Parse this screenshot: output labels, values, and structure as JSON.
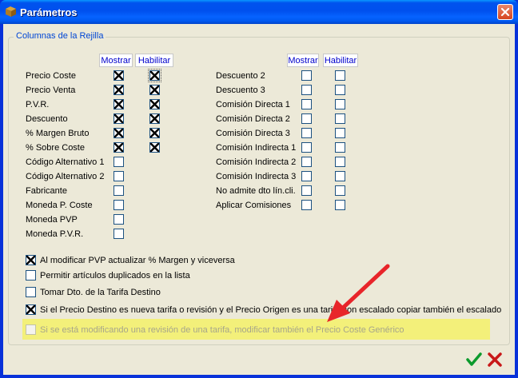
{
  "window": {
    "title": "Parámetros"
  },
  "group": {
    "title": "Columnas de la Rejilla"
  },
  "left": {
    "headers": [
      "Mostrar",
      "Habilitar"
    ],
    "rows": [
      {
        "label": "Precio Coste",
        "show": true,
        "enable": true,
        "enable_focus": true
      },
      {
        "label": "Precio Venta",
        "show": true,
        "enable": true
      },
      {
        "label": "P.V.R.",
        "show": true,
        "enable": true
      },
      {
        "label": "Descuento",
        "show": true,
        "enable": true
      },
      {
        "label": "% Margen Bruto",
        "show": true,
        "enable": true
      },
      {
        "label": "% Sobre Coste",
        "show": true,
        "enable": true
      },
      {
        "label": "Código Alternativo 1",
        "show": false
      },
      {
        "label": "Código Alternativo 2",
        "show": false
      },
      {
        "label": "Fabricante",
        "show": false
      },
      {
        "label": "Moneda P. Coste",
        "show": false
      },
      {
        "label": "Moneda PVP",
        "show": false
      },
      {
        "label": "Moneda P.V.R.",
        "show": false
      }
    ]
  },
  "right": {
    "headers": [
      "Mostrar",
      "Habilitar"
    ],
    "rows": [
      {
        "label": "Descuento 2",
        "show": false,
        "enable": false
      },
      {
        "label": "Descuento 3",
        "show": false,
        "enable": false
      },
      {
        "label": "Comisión Directa 1",
        "show": false,
        "enable": false
      },
      {
        "label": "Comisión Directa 2",
        "show": false,
        "enable": false
      },
      {
        "label": "Comisión Directa 3",
        "show": false,
        "enable": false
      },
      {
        "label": "Comisión Indirecta 1",
        "show": false,
        "enable": false
      },
      {
        "label": "Comisión Indirecta 2",
        "show": false,
        "enable": false
      },
      {
        "label": "Comisión Indirecta 3",
        "show": false,
        "enable": false
      },
      {
        "label": "No admite dto lín.cli.",
        "show": false,
        "enable": false
      },
      {
        "label": "Aplicar Comisiones",
        "show": false,
        "enable": false
      }
    ]
  },
  "options": [
    {
      "label": "Al modificar PVP actualizar % Margen y viceversa",
      "checked": true
    },
    {
      "label": "Permitir artículos duplicados en la lista",
      "checked": false
    },
    {
      "label": "Tomar Dto. de la Tarifa Destino",
      "checked": false
    },
    {
      "label": "Si el Precio Destino es nueva tarifa o revisión y el Precio Origen es una tarifa con escalado copiar también el escalado",
      "checked": true
    },
    {
      "label": "Si se está modificando una revisión de una tarifa, modificar también el Precio Coste Genérico",
      "checked": false,
      "disabled": true
    }
  ],
  "colors": {
    "highlight": "#f3f07a",
    "arrow": "#e8252a",
    "title_bar": "#0053ee",
    "header_text": "#0000cc"
  }
}
